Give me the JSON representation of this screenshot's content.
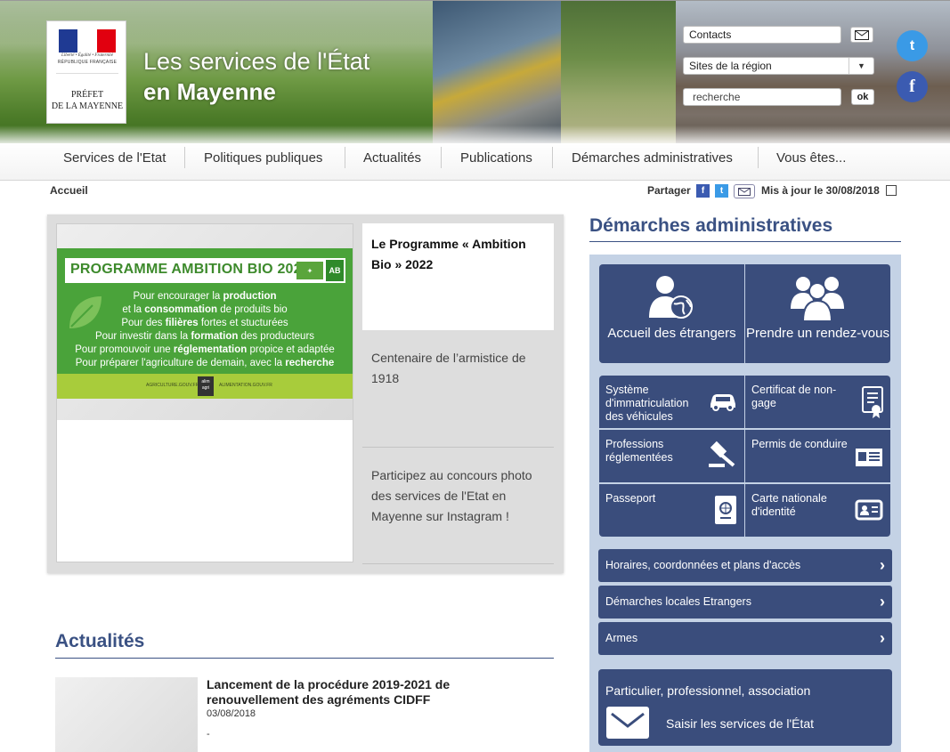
{
  "header": {
    "motto": "Liberté • Égalité • Fraternité",
    "republic": "RÉPUBLIQUE FRANÇAISE",
    "prefet_line1": "PRÉFET",
    "prefet_line2": "DE LA MAYENNE",
    "title_line1": "Les services de l'État",
    "title_line2": "en Mayenne",
    "contacts_value": "Contacts",
    "sites_value": "Sites de la région",
    "search_value": "recherche",
    "ok_label": "ok",
    "twitter_glyph": "t",
    "facebook_glyph": "f"
  },
  "nav": {
    "items": [
      "Services de l'Etat",
      "Politiques publiques",
      "Actualités",
      "Publications",
      "Démarches administratives",
      "Vous êtes..."
    ]
  },
  "breadcrumb": "Accueil",
  "share": {
    "label": "Partager",
    "fb": "f",
    "tw": "t",
    "updated": "Mis à jour le 30/08/2018"
  },
  "carousel": {
    "banner_title": "PROGRAMME AMBITION BIO 2022",
    "banner_ab": "AB",
    "banner_lines": [
      [
        "Pour encourager la ",
        "production",
        ""
      ],
      [
        "et la ",
        "consommation",
        " de produits bio"
      ],
      [
        "Pour des ",
        "filières",
        " fortes et stucturées"
      ],
      [
        "Pour investir dans la ",
        "formation",
        " des producteurs"
      ],
      [
        "Pour promouvoir une ",
        "réglementation",
        " propice et adaptée"
      ],
      [
        "Pour préparer l'agriculture de demain, avec la ",
        "recherche",
        ""
      ]
    ],
    "banner_footer_left": "AGRICULTURE.GOUV.FR",
    "banner_footer_right": "ALIMENTATION.GOUV.FR",
    "banner_logo": "alim agri",
    "active_item": "Le Programme « Ambition Bio » 2022",
    "item2": "Centenaire de l’armistice de 1918",
    "item3": "Participez au concours photo des services de l'Etat en Mayenne sur Instagram !"
  },
  "actualites": {
    "title": "Actualités",
    "news_title": "Lancement de la procédure 2019-2021 de renouvellement des agréments CIDFF",
    "news_date": "03/08/2018",
    "news_dash": "-"
  },
  "demarches": {
    "title": "Démarches administratives",
    "big_tiles": [
      "Accueil des étrangers",
      "Prendre un rendez-vous"
    ],
    "small_tiles": [
      "Système d'immatriculation des véhicules",
      "Certificat de non-gage",
      "Professions réglementées",
      "Permis de conduire",
      "Passeport",
      "Carte nationale d'identité"
    ],
    "strips": [
      "Horaires, coordonnées et plans d'accès",
      "Démarches locales Etrangers",
      "Armes"
    ],
    "contact_sub": "Particulier, professionnel, association",
    "contact_link": "Saisir les services de l'État"
  },
  "colors": {
    "brand_blue": "#3a4d7c",
    "title_blue": "#3a5183",
    "panel_bg": "#c4d2e5",
    "bio_green": "#4aa33a"
  },
  "icons": [
    "mail-icon",
    "dropdown-arrow-icon",
    "twitter-icon",
    "facebook-icon",
    "print-icon",
    "leaf-icon",
    "person-globe-icon",
    "group-icon",
    "car-icon",
    "certificate-icon",
    "gavel-icon",
    "license-card-icon",
    "passport-icon",
    "id-card-icon",
    "chevron-right-icon",
    "envelope-icon"
  ]
}
